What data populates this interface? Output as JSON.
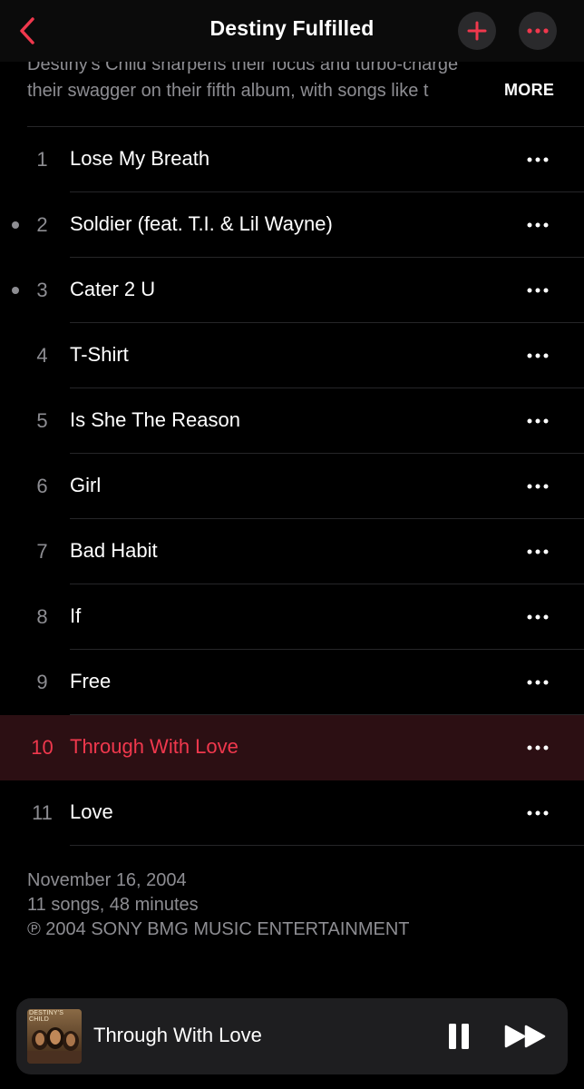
{
  "header": {
    "title": "Destiny Fulfilled",
    "back_icon": "chevron-left-icon",
    "add_icon": "plus-icon",
    "more_icon": "ellipsis-icon",
    "accent_color": "#f0384d"
  },
  "description": {
    "line1": "Destiny's Child sharpens their focus and turbo-charge",
    "line2": "their swagger on their fifth album, with songs like t",
    "more_label": "MORE"
  },
  "tracks": [
    {
      "number": "1",
      "title": "Lose My Breath"
    },
    {
      "number": "2",
      "title": "Soldier (feat. T.I. & Lil Wayne)"
    },
    {
      "number": "3",
      "title": "Cater 2 U"
    },
    {
      "number": "4",
      "title": "T-Shirt"
    },
    {
      "number": "5",
      "title": "Is She The Reason"
    },
    {
      "number": "6",
      "title": "Girl"
    },
    {
      "number": "7",
      "title": "Bad Habit"
    },
    {
      "number": "8",
      "title": "If"
    },
    {
      "number": "9",
      "title": "Free"
    },
    {
      "number": "10",
      "title": "Through With Love"
    },
    {
      "number": "11",
      "title": "Love"
    }
  ],
  "footer": {
    "release_date": "November 16, 2004",
    "summary": "11 songs, 48 minutes",
    "copyright": "℗ 2004 SONY BMG MUSIC ENTERTAINMENT"
  },
  "now_playing": {
    "title": "Through With Love",
    "artwork_text": "DESTINY'S CHILD",
    "pause_icon": "pause-icon",
    "forward_icon": "fast-forward-icon"
  }
}
